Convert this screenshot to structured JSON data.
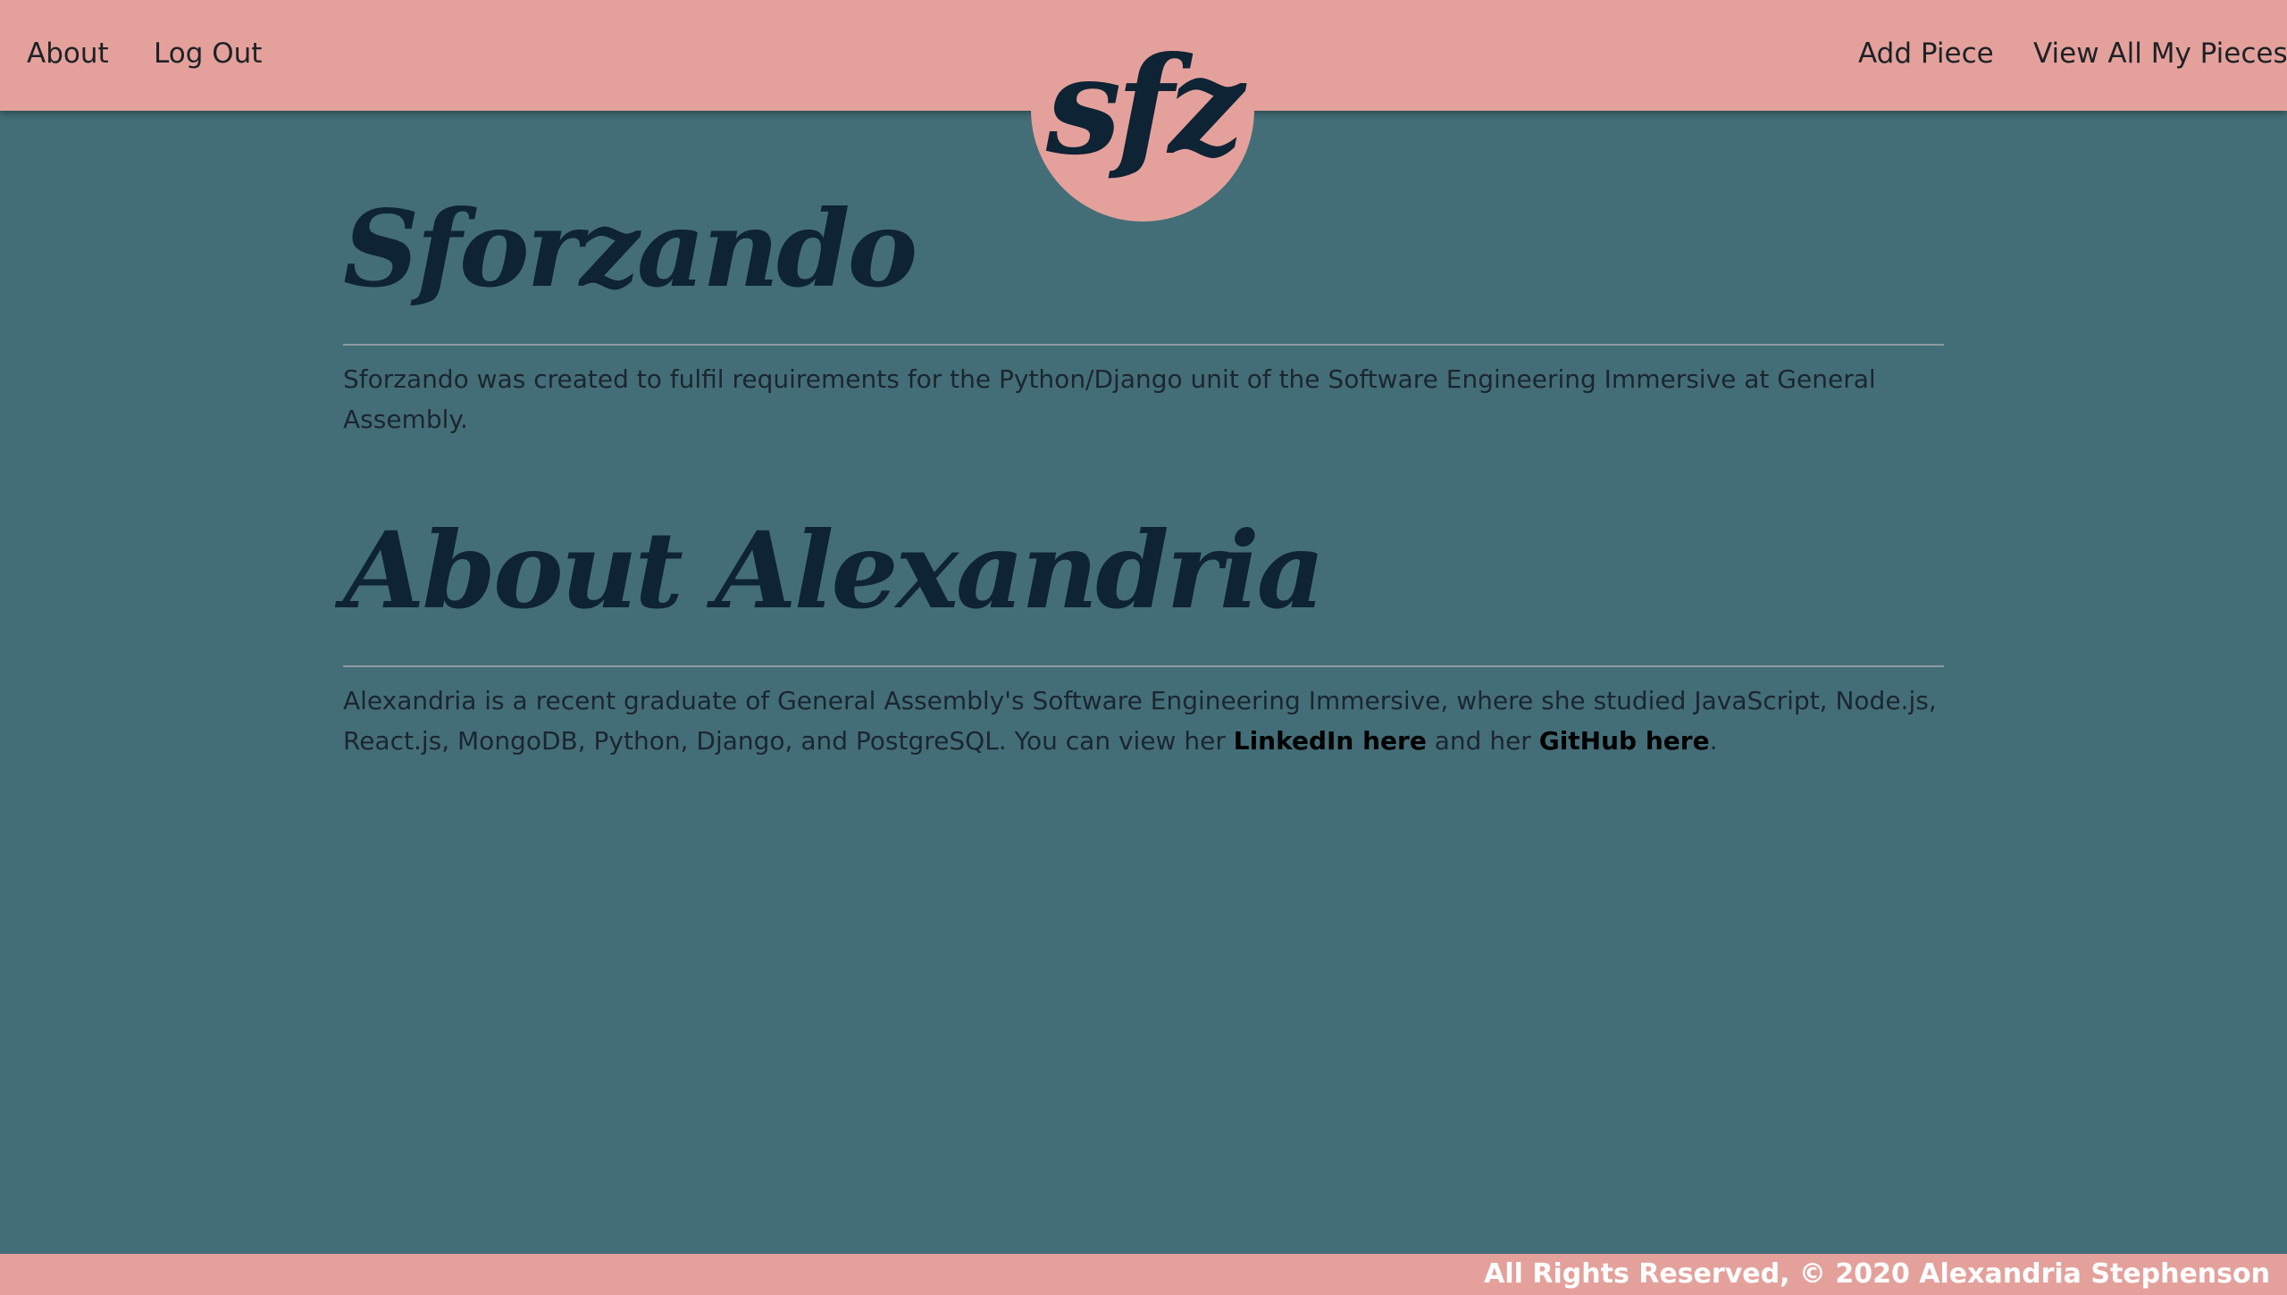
{
  "nav": {
    "about": "About",
    "logout": "Log Out",
    "add_piece": "Add Piece",
    "view_all": "View All My Pieces",
    "logo": "sfz"
  },
  "sections": [
    {
      "heading": "Sforzando",
      "text": "Sforzando was created to fulfil requirements for the Python/Django unit of the Software Engineering Immersive at General Assembly."
    },
    {
      "heading": "About Alexandria",
      "text_before": "Alexandria is a recent graduate of General Assembly's Software Engineering Immersive, where she studied JavaScript, Node.js, React.js, MongoDB, Python, Django, and PostgreSQL. You can view her ",
      "link1": "LinkedIn here",
      "text_middle": " and her ",
      "link2": "GitHub here",
      "text_after": "."
    }
  ],
  "footer": {
    "text": "All Rights Reserved, © 2020 Alexandria Stephenson"
  },
  "colors": {
    "background": "#446e77",
    "nav_background": "#e4a19c",
    "heading": "#0e2334",
    "footer_text": "#ffffff"
  }
}
